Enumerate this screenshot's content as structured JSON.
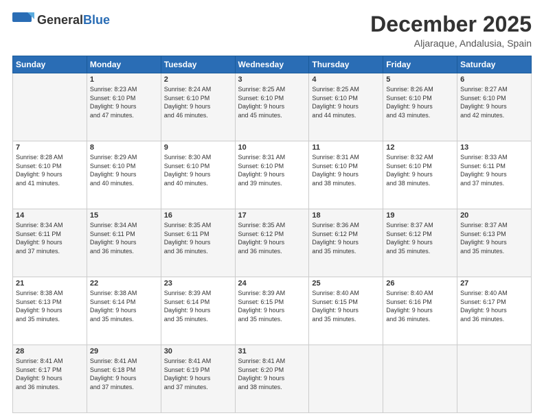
{
  "header": {
    "logo_general": "General",
    "logo_blue": "Blue",
    "month_title": "December 2025",
    "location": "Aljaraque, Andalusia, Spain"
  },
  "days_of_week": [
    "Sunday",
    "Monday",
    "Tuesday",
    "Wednesday",
    "Thursday",
    "Friday",
    "Saturday"
  ],
  "weeks": [
    [
      {
        "day": "",
        "info": ""
      },
      {
        "day": "1",
        "info": "Sunrise: 8:23 AM\nSunset: 6:10 PM\nDaylight: 9 hours\nand 47 minutes."
      },
      {
        "day": "2",
        "info": "Sunrise: 8:24 AM\nSunset: 6:10 PM\nDaylight: 9 hours\nand 46 minutes."
      },
      {
        "day": "3",
        "info": "Sunrise: 8:25 AM\nSunset: 6:10 PM\nDaylight: 9 hours\nand 45 minutes."
      },
      {
        "day": "4",
        "info": "Sunrise: 8:25 AM\nSunset: 6:10 PM\nDaylight: 9 hours\nand 44 minutes."
      },
      {
        "day": "5",
        "info": "Sunrise: 8:26 AM\nSunset: 6:10 PM\nDaylight: 9 hours\nand 43 minutes."
      },
      {
        "day": "6",
        "info": "Sunrise: 8:27 AM\nSunset: 6:10 PM\nDaylight: 9 hours\nand 42 minutes."
      }
    ],
    [
      {
        "day": "7",
        "info": "Sunrise: 8:28 AM\nSunset: 6:10 PM\nDaylight: 9 hours\nand 41 minutes."
      },
      {
        "day": "8",
        "info": "Sunrise: 8:29 AM\nSunset: 6:10 PM\nDaylight: 9 hours\nand 40 minutes."
      },
      {
        "day": "9",
        "info": "Sunrise: 8:30 AM\nSunset: 6:10 PM\nDaylight: 9 hours\nand 40 minutes."
      },
      {
        "day": "10",
        "info": "Sunrise: 8:31 AM\nSunset: 6:10 PM\nDaylight: 9 hours\nand 39 minutes."
      },
      {
        "day": "11",
        "info": "Sunrise: 8:31 AM\nSunset: 6:10 PM\nDaylight: 9 hours\nand 38 minutes."
      },
      {
        "day": "12",
        "info": "Sunrise: 8:32 AM\nSunset: 6:10 PM\nDaylight: 9 hours\nand 38 minutes."
      },
      {
        "day": "13",
        "info": "Sunrise: 8:33 AM\nSunset: 6:11 PM\nDaylight: 9 hours\nand 37 minutes."
      }
    ],
    [
      {
        "day": "14",
        "info": "Sunrise: 8:34 AM\nSunset: 6:11 PM\nDaylight: 9 hours\nand 37 minutes."
      },
      {
        "day": "15",
        "info": "Sunrise: 8:34 AM\nSunset: 6:11 PM\nDaylight: 9 hours\nand 36 minutes."
      },
      {
        "day": "16",
        "info": "Sunrise: 8:35 AM\nSunset: 6:11 PM\nDaylight: 9 hours\nand 36 minutes."
      },
      {
        "day": "17",
        "info": "Sunrise: 8:35 AM\nSunset: 6:12 PM\nDaylight: 9 hours\nand 36 minutes."
      },
      {
        "day": "18",
        "info": "Sunrise: 8:36 AM\nSunset: 6:12 PM\nDaylight: 9 hours\nand 35 minutes."
      },
      {
        "day": "19",
        "info": "Sunrise: 8:37 AM\nSunset: 6:12 PM\nDaylight: 9 hours\nand 35 minutes."
      },
      {
        "day": "20",
        "info": "Sunrise: 8:37 AM\nSunset: 6:13 PM\nDaylight: 9 hours\nand 35 minutes."
      }
    ],
    [
      {
        "day": "21",
        "info": "Sunrise: 8:38 AM\nSunset: 6:13 PM\nDaylight: 9 hours\nand 35 minutes."
      },
      {
        "day": "22",
        "info": "Sunrise: 8:38 AM\nSunset: 6:14 PM\nDaylight: 9 hours\nand 35 minutes."
      },
      {
        "day": "23",
        "info": "Sunrise: 8:39 AM\nSunset: 6:14 PM\nDaylight: 9 hours\nand 35 minutes."
      },
      {
        "day": "24",
        "info": "Sunrise: 8:39 AM\nSunset: 6:15 PM\nDaylight: 9 hours\nand 35 minutes."
      },
      {
        "day": "25",
        "info": "Sunrise: 8:40 AM\nSunset: 6:15 PM\nDaylight: 9 hours\nand 35 minutes."
      },
      {
        "day": "26",
        "info": "Sunrise: 8:40 AM\nSunset: 6:16 PM\nDaylight: 9 hours\nand 36 minutes."
      },
      {
        "day": "27",
        "info": "Sunrise: 8:40 AM\nSunset: 6:17 PM\nDaylight: 9 hours\nand 36 minutes."
      }
    ],
    [
      {
        "day": "28",
        "info": "Sunrise: 8:41 AM\nSunset: 6:17 PM\nDaylight: 9 hours\nand 36 minutes."
      },
      {
        "day": "29",
        "info": "Sunrise: 8:41 AM\nSunset: 6:18 PM\nDaylight: 9 hours\nand 37 minutes."
      },
      {
        "day": "30",
        "info": "Sunrise: 8:41 AM\nSunset: 6:19 PM\nDaylight: 9 hours\nand 37 minutes."
      },
      {
        "day": "31",
        "info": "Sunrise: 8:41 AM\nSunset: 6:20 PM\nDaylight: 9 hours\nand 38 minutes."
      },
      {
        "day": "",
        "info": ""
      },
      {
        "day": "",
        "info": ""
      },
      {
        "day": "",
        "info": ""
      }
    ]
  ]
}
